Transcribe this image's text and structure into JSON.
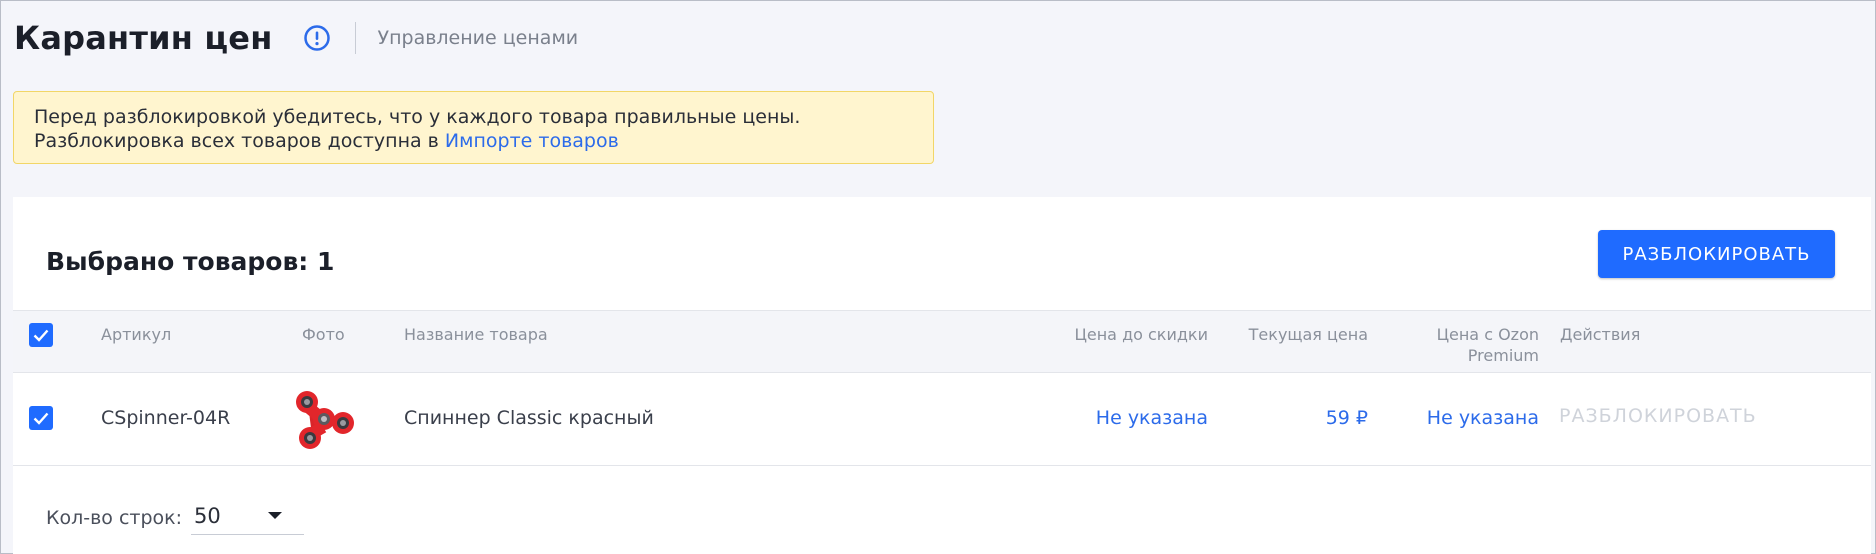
{
  "header": {
    "title": "Карантин цен",
    "breadcrumb_link": "Управление ценами"
  },
  "notice": {
    "line1": "Перед разблокировкой убедитесь, что у каждого товара правильные цены.",
    "line2_prefix": "Разблокировка всех товаров доступна в ",
    "line2_link": "Импорте товаров"
  },
  "selection": {
    "label": "Выбрано товаров: 1",
    "unlock_button": "РАЗБЛОКИРОВАТЬ"
  },
  "table": {
    "columns": {
      "sku": "Артикул",
      "photo": "Фото",
      "name": "Название товара",
      "price_before_discount": "Цена до скидки",
      "current_price": "Текущая цена",
      "premium_price_line1": "Цена с Ozon",
      "premium_price_line2": "Premium",
      "actions": "Действия"
    },
    "rows": [
      {
        "checked": true,
        "sku": "CSpinner-04R",
        "photo_icon": "red-fidget-spinner",
        "name": "Спиннер Classic красный",
        "price_before_discount": "Не указана",
        "current_price": "59 ₽",
        "premium_price": "Не указана",
        "action": "РАЗБЛОКИРОВАТЬ"
      }
    ]
  },
  "pagination": {
    "rows_label": "Кол-во строк:",
    "rows_value": "50"
  },
  "colors": {
    "accent": "#1f6bff",
    "link": "#2c6bea",
    "notice_bg": "#fff5cf",
    "notice_border": "#f2d667"
  }
}
